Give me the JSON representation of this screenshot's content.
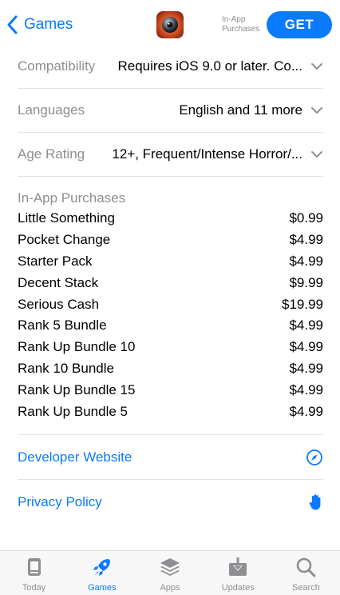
{
  "nav": {
    "back_label": "Games",
    "iap_note_line1": "In-App",
    "iap_note_line2": "Purchases",
    "get_label": "GET"
  },
  "info": {
    "compatibility": {
      "key": "Compatibility",
      "value": "Requires iOS 9.0 or later. Co..."
    },
    "languages": {
      "key": "Languages",
      "value": "English and 11 more"
    },
    "age_rating": {
      "key": "Age Rating",
      "value": "12+, Frequent/Intense Horror/..."
    }
  },
  "in_app_purchases": {
    "title": "In-App Purchases",
    "items": [
      {
        "name": "Little Something",
        "price": "$0.99"
      },
      {
        "name": "Pocket Change",
        "price": "$4.99"
      },
      {
        "name": "Starter Pack",
        "price": "$4.99"
      },
      {
        "name": "Decent Stack",
        "price": "$9.99"
      },
      {
        "name": "Serious Cash",
        "price": "$19.99"
      },
      {
        "name": "Rank 5 Bundle",
        "price": "$4.99"
      },
      {
        "name": "Rank Up Bundle 10",
        "price": "$4.99"
      },
      {
        "name": "Rank 10 Bundle",
        "price": "$4.99"
      },
      {
        "name": "Rank Up Bundle 15",
        "price": "$4.99"
      },
      {
        "name": "Rank Up Bundle 5",
        "price": "$4.99"
      }
    ]
  },
  "links": {
    "developer_website": {
      "label": "Developer Website",
      "icon": "compass-icon"
    },
    "privacy_policy": {
      "label": "Privacy Policy",
      "icon": "hand-icon"
    }
  },
  "tabbar": {
    "tabs": [
      {
        "label": "Today",
        "icon": "today-icon",
        "active": false
      },
      {
        "label": "Games",
        "icon": "rocket-icon",
        "active": true
      },
      {
        "label": "Apps",
        "icon": "stack-icon",
        "active": false
      },
      {
        "label": "Updates",
        "icon": "download-icon",
        "active": false
      },
      {
        "label": "Search",
        "icon": "search-icon",
        "active": false
      }
    ]
  },
  "colors": {
    "accent": "#0a7aff",
    "secondary_text": "#8e8e93",
    "separator": "#e3e3e6",
    "inactive_tab": "#8e8e93"
  }
}
